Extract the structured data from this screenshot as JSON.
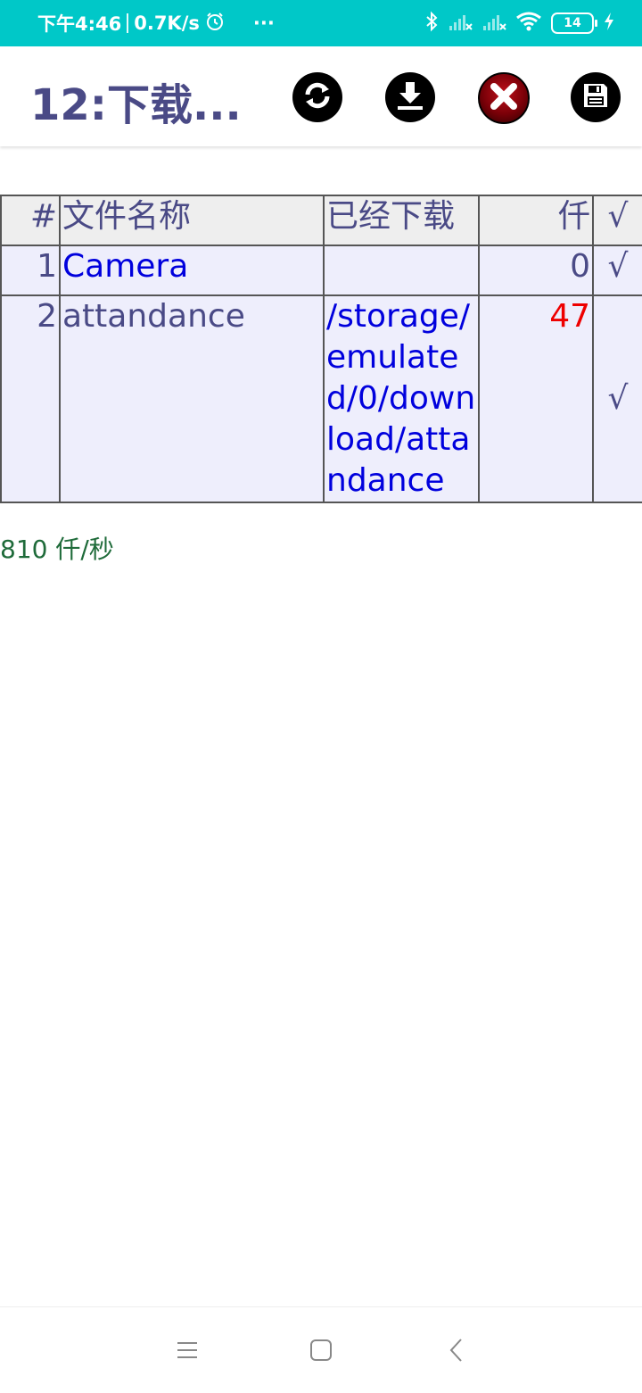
{
  "status_bar": {
    "time": "下午4:46",
    "net_speed": "0.7K/s",
    "more": "···",
    "battery": "14"
  },
  "app_bar": {
    "title": "12:下载...",
    "actions": [
      "refresh-icon",
      "download-icon",
      "cancel-icon",
      "save-icon"
    ]
  },
  "table": {
    "headers": [
      "#",
      "文件名称",
      "已经下载",
      "仟",
      "√"
    ],
    "rows": [
      {
        "num": "1",
        "name": "Camera",
        "downloaded": "",
        "count": "0",
        "check": "√"
      },
      {
        "num": "2",
        "name": "attandance",
        "downloaded": "/storage/emulated/0/download/attandance",
        "count": "47",
        "check": "√"
      }
    ]
  },
  "speed": "810 仟/秒",
  "colors": {
    "status_bar": "#00c8c8",
    "title": "#4a4a86",
    "link": "#0000dd",
    "count_alert": "#ee0000",
    "speed": "#1f6b3a"
  }
}
